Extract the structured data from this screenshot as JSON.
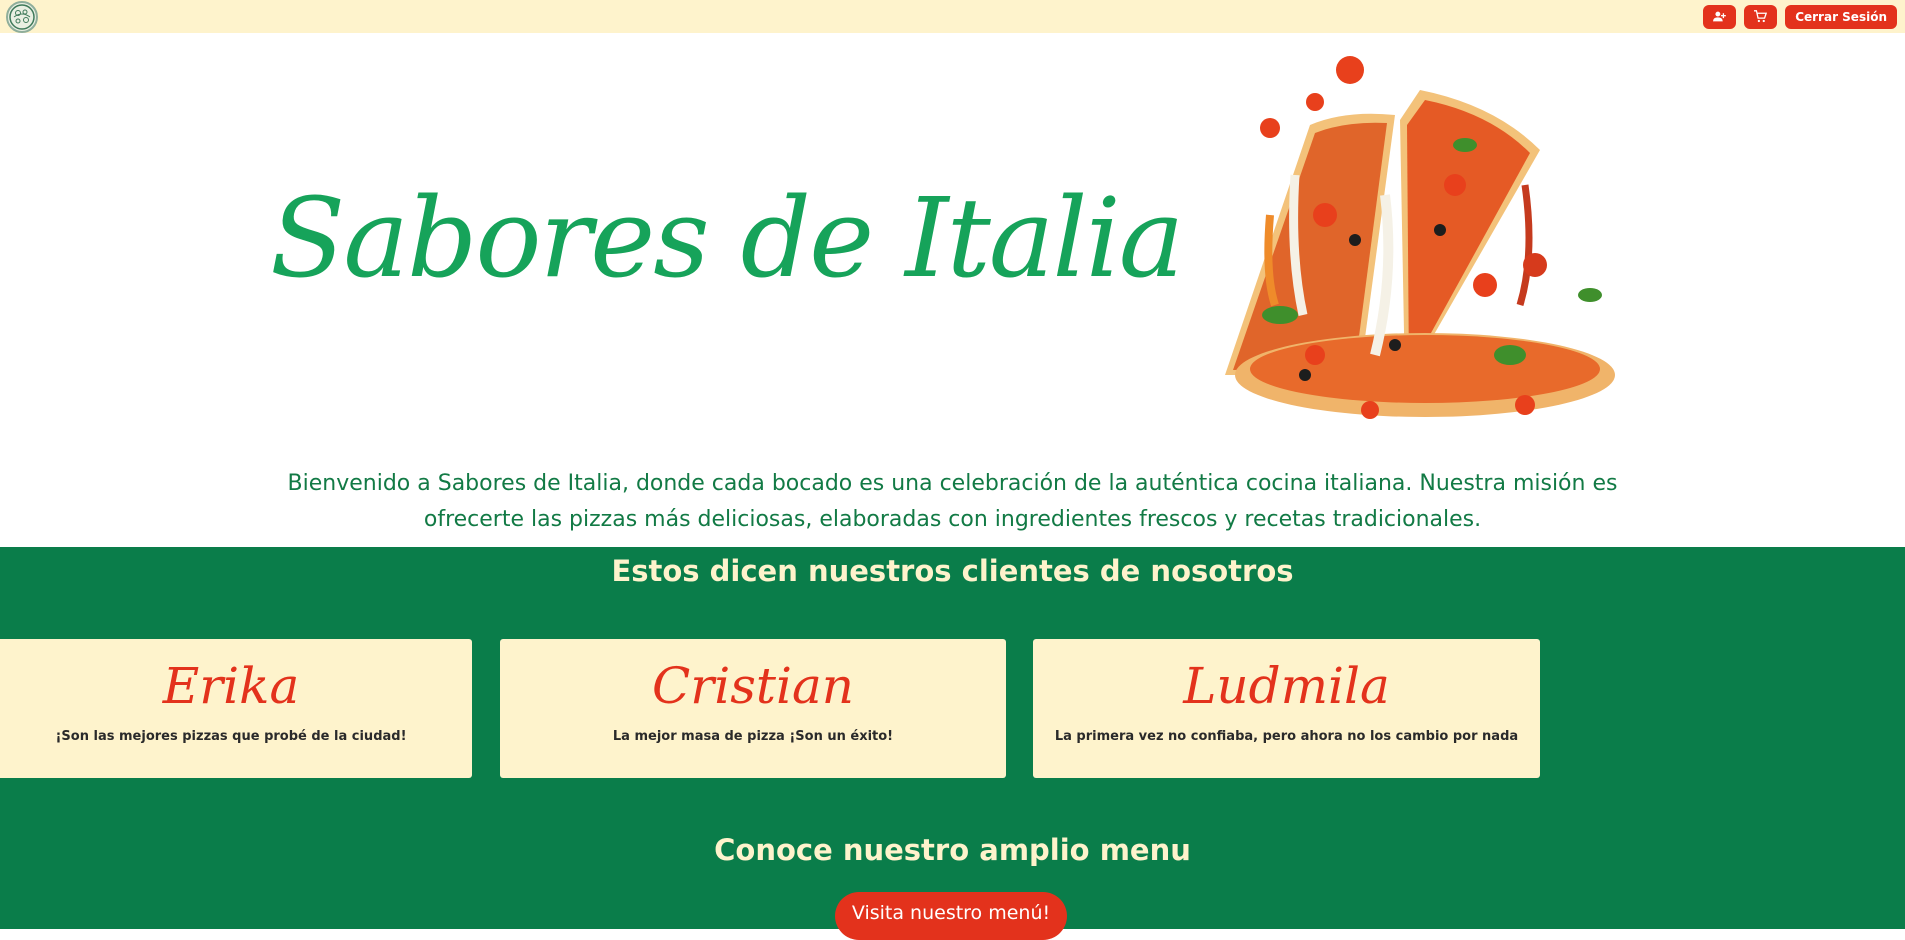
{
  "header": {
    "logo_icon": "pizza-logo-icon",
    "user_icon": "user-plus-icon",
    "cart_icon": "cart-icon",
    "logout_label": "Cerrar Sesión",
    "background_color": "#fef3cc",
    "button_color": "#e3321c"
  },
  "hero": {
    "title": "Sabores de Italia",
    "image_icon": "pizza-slices-illustration",
    "intro_text": "Bienvenido a Sabores de Italia, donde cada bocado es una celebración de la auténtica cocina italiana. Nuestra misión es ofrecerte las pizzas más deliciosas, elaboradas con ingredientes frescos y recetas tradicionales.",
    "title_color": "#16a35a"
  },
  "reviews": {
    "title": "Estos dicen nuestros clientes de nosotros",
    "items": [
      {
        "name": "Erika",
        "text": "¡Son las mejores pizzas que probé de la ciudad!"
      },
      {
        "name": "Cristian",
        "text": "La mejor masa de pizza ¡Son un éxito!"
      },
      {
        "name": "Ludmila",
        "text": "La primera vez no confiaba, pero ahora no los cambio por nada"
      }
    ],
    "band_color": "#0a7d4a",
    "card_color": "#fef3cc",
    "name_color": "#e3321c"
  },
  "menu": {
    "title": "Conoce nuestro amplio menu",
    "button_label": "Visita nuestro menú!"
  }
}
